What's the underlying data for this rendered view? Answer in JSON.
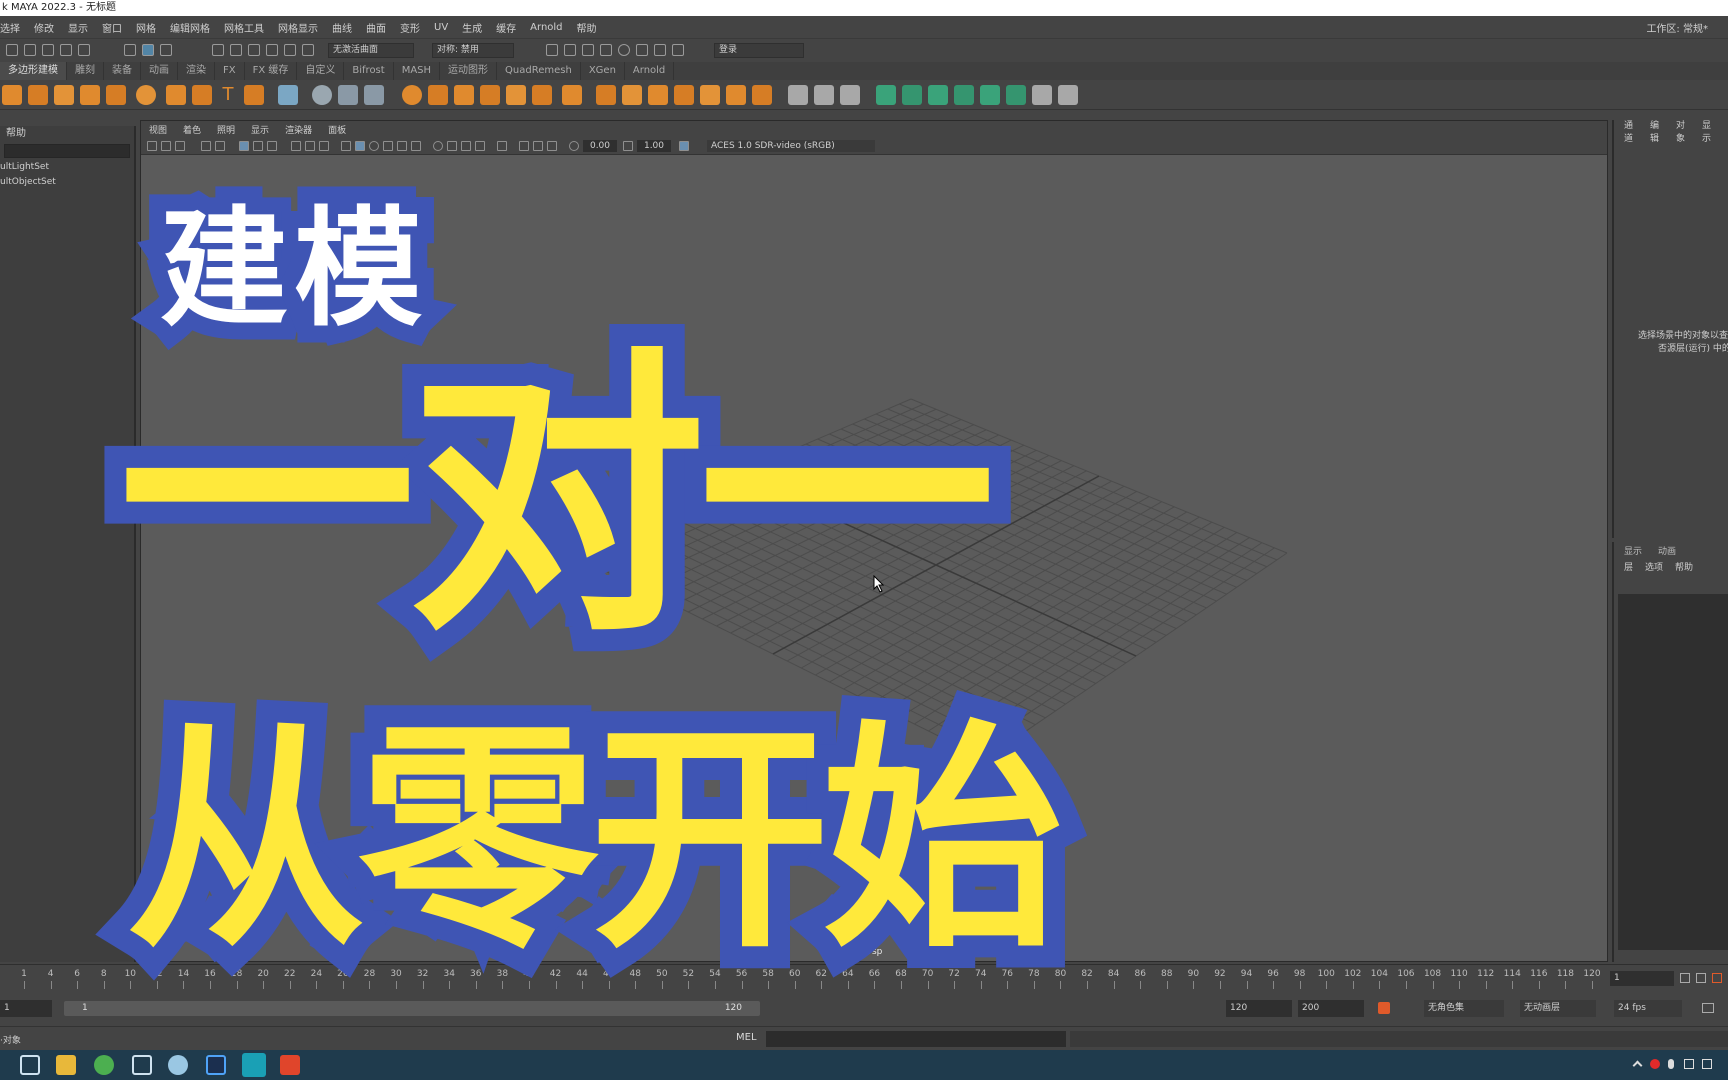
{
  "app": {
    "title": "k MAYA 2022.3 - 无标题",
    "workspace_label": "工作区: 常规*"
  },
  "menubar": [
    "选择",
    "修改",
    "显示",
    "窗口",
    "网格",
    "编辑网格",
    "网格工具",
    "网格显示",
    "曲线",
    "曲面",
    "变形",
    "UV",
    "生成",
    "缓存",
    "Arnold",
    "帮助"
  ],
  "statusline": {
    "mode_field": "无激活曲面",
    "symmetry_field": "对称: 禁用",
    "login_field": "登录"
  },
  "shelf_tabs": [
    "多边形建模",
    "雕刻",
    "装备",
    "动画",
    "渲染",
    "FX",
    "FX 缓存",
    "自定义",
    "Bifrost",
    "MASH",
    "运动图形",
    "QuadRemesh",
    "XGen",
    "Arnold"
  ],
  "outliner": {
    "header": "帮助",
    "items": [
      "",
      "",
      "",
      "",
      "ultLightSet",
      "ultObjectSet"
    ]
  },
  "viewport": {
    "menu": [
      "视图",
      "着色",
      "照明",
      "显示",
      "渲染器",
      "面板"
    ],
    "exposure": "0.00",
    "gamma": "1.00",
    "colorspace": "ACES 1.0 SDR-video (sRGB)",
    "camera": "persp"
  },
  "channelbox": {
    "tabs": [
      "通道",
      "编辑",
      "对象",
      "显示"
    ],
    "hint_line1": "选择场景中的对象以查",
    "hint_line2": "否源层(运行) 中的"
  },
  "layereditor": {
    "tabs": [
      "显示",
      "动画"
    ],
    "menu": [
      "层",
      "选项",
      "帮助"
    ]
  },
  "timeline": {
    "ticks": [
      "1",
      "4",
      "6",
      "8",
      "10",
      "12",
      "14",
      "16",
      "18",
      "20",
      "22",
      "24",
      "26",
      "28",
      "30",
      "32",
      "34",
      "36",
      "38",
      "40",
      "42",
      "44",
      "46",
      "48",
      "50",
      "52",
      "54",
      "56",
      "58",
      "60",
      "62",
      "64",
      "66",
      "68",
      "70",
      "72",
      "74",
      "76",
      "78",
      "80",
      "82",
      "84",
      "86",
      "88",
      "90",
      "92",
      "94",
      "96",
      "98",
      "100",
      "102",
      "104",
      "106",
      "108",
      "110",
      "112",
      "114",
      "116",
      "118",
      "120"
    ],
    "current_frame": "1"
  },
  "range": {
    "start": "1",
    "inner_start": "1",
    "inner_end": "120",
    "end": "120",
    "anim_end": "200",
    "char_set": "无角色集",
    "anim_layer": "无动画层",
    "fps": "24 fps"
  },
  "cmdline": {
    "label": "MEL",
    "status": "·对象"
  },
  "overlay": {
    "line1": "建模",
    "line2": "一对一",
    "line3": "从零开始"
  },
  "colors": {
    "overlay_yellow": "#ffe93b",
    "overlay_blue": "#3f55b4",
    "maya_bg": "#444444",
    "viewport": "#5b5b5b"
  },
  "taskbar_icons": [
    "task-view-icon",
    "file-explorer-icon",
    "browser-icon",
    "app-icon",
    "bird-app-icon",
    "photoshop-icon",
    "maya-icon",
    "xmind-icon"
  ]
}
